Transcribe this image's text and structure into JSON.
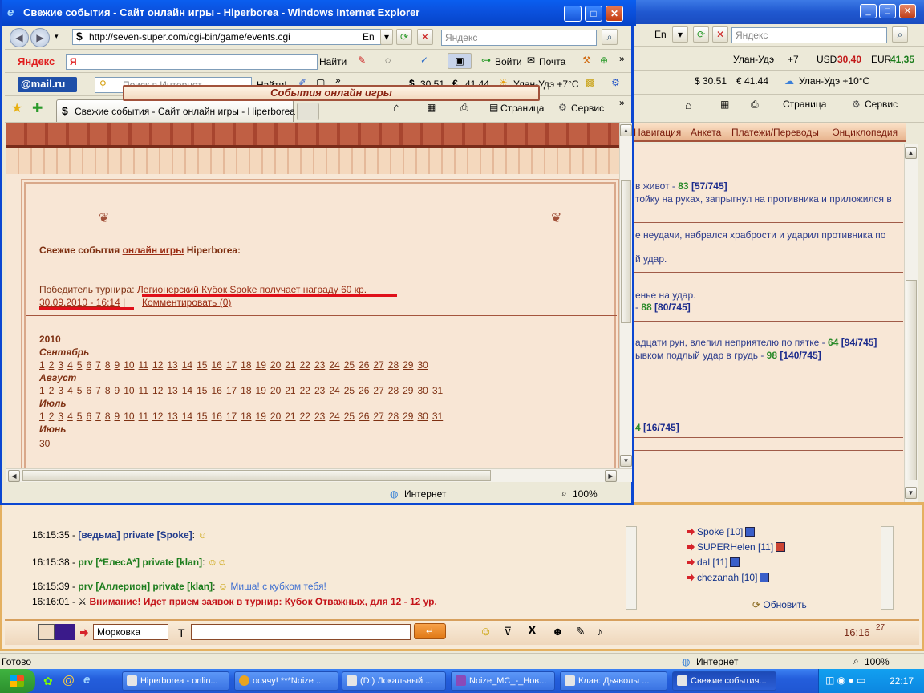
{
  "foreground": {
    "window_title": "Свежие события - Сайт онлайн игры - Hiperborea - Windows Internet Explorer",
    "address": "http://seven-super.com/cgi-bin/game/events.cgi",
    "address_lang": "En",
    "search_placeholder": "Яндекс",
    "yandex_logo": "Яндекс",
    "yandex_input": "Я",
    "find_label": "Найти",
    "login_label": "Войти",
    "mail_label": "Почта",
    "mailru_logo": "@mail.ru",
    "mailru_search_placeholder": "Поиск в Интернет",
    "mailru_find": "Найти!",
    "usd_rate": "30.51",
    "eur_rate": "41.44",
    "weather": "Улан-Удэ +7°C",
    "tab_title": "Свежие события - Сайт онлайн игры - Hiperborea",
    "page_menu": "Страница",
    "service_menu": "Сервис",
    "status_zone": "Интернет",
    "zoom": "100%"
  },
  "content": {
    "banner": "События онлайн игры",
    "heading_pre": "Свежие события",
    "heading_link": "онлайн игры",
    "heading_post": "Hiperborea:",
    "winner_label": "Победитель турнира:",
    "winner_text": "Легионерский Кубок Spoke получает награду 60 кр.",
    "date": "30.09.2010 - 16:14",
    "sep": "|",
    "comment": "Комментировать (0)",
    "year": "2010",
    "months": [
      {
        "name": "Сентябрь",
        "days": [
          "1",
          "2",
          "3",
          "4",
          "5",
          "6",
          "7",
          "8",
          "9",
          "10",
          "11",
          "12",
          "13",
          "14",
          "15",
          "16",
          "17",
          "18",
          "19",
          "20",
          "21",
          "22",
          "23",
          "24",
          "25",
          "26",
          "27",
          "28",
          "29",
          "30"
        ]
      },
      {
        "name": "Август",
        "days": [
          "1",
          "2",
          "3",
          "4",
          "5",
          "6",
          "7",
          "8",
          "9",
          "10",
          "11",
          "12",
          "13",
          "14",
          "15",
          "16",
          "17",
          "18",
          "19",
          "20",
          "21",
          "22",
          "23",
          "24",
          "25",
          "26",
          "27",
          "28",
          "29",
          "30",
          "31"
        ]
      },
      {
        "name": "Июль",
        "days": [
          "1",
          "2",
          "3",
          "4",
          "5",
          "6",
          "7",
          "8",
          "9",
          "10",
          "11",
          "12",
          "13",
          "14",
          "15",
          "16",
          "17",
          "18",
          "19",
          "20",
          "21",
          "22",
          "23",
          "24",
          "25",
          "26",
          "27",
          "28",
          "29",
          "30",
          "31"
        ]
      },
      {
        "name": "Июнь",
        "days": [
          "30"
        ]
      }
    ]
  },
  "background": {
    "address_lang": "En",
    "search_placeholder": "Яндекс",
    "city": "Улан-Удэ",
    "temp": "+7",
    "usd_label": "USD",
    "usd_value": "30,40",
    "eur_label": "EUR",
    "eur_value": "41,35",
    "usd_rate": "30.51",
    "eur_rate": "41.44",
    "weather": "Улан-Удэ +10°C",
    "page_menu": "Страница",
    "service_menu": "Сервис",
    "nav": [
      "Навигация",
      "Анкета",
      "Платежи/Переводы",
      "Энциклопедия"
    ],
    "log": [
      {
        "pre": "в живот - ",
        "g": "83",
        "n": "[57/745]"
      },
      {
        "pre": "тойку на руках, запрыгнул на противника и приложился в",
        "g": "",
        "n": ""
      },
      {
        "pre": "е неудачи, набрался храбрости и ударил противника по",
        "g": "",
        "n": ""
      },
      {
        "pre": "й удар.",
        "g": "",
        "n": ""
      },
      {
        "pre": "енье на удар.",
        "g": "",
        "n": ""
      },
      {
        "pre": " - ",
        "g": "88",
        "n": "[80/745]"
      },
      {
        "pre": "адцати рун, влепил неприятелю по пятке - ",
        "g": "64",
        "n": "[94/745]"
      },
      {
        "pre": "ывком подлый удар в грудь - ",
        "g": "98",
        "n": "[140/745]"
      },
      {
        "pre": "",
        "g": "4",
        "n": "[16/745]"
      }
    ],
    "status_left": "Готово",
    "status_zone": "Интернет",
    "zoom": "100%"
  },
  "chat": {
    "lines": [
      {
        "time": "16:15:35 - ",
        "nick": "[ведьма] private [Spoke]",
        "tail": ":",
        "msg": ""
      },
      {
        "time": "16:15:38 - ",
        "nick": "prv [*ЕлесА*] private [klan]",
        "tail": ":",
        "msg": ""
      },
      {
        "time": "16:15:39 - ",
        "nick": "prv [Аллерион] private [klan]",
        "tail": ":",
        "msg": "Миша! с кубком тебя!"
      }
    ],
    "alert_time": "16:16:01 - ",
    "alert": "Внимание! Идет прием заявок в турнир: Кубок Отважных, для 12 - 12 ур.",
    "users": [
      {
        "name": "Spoke",
        "level": "[10]"
      },
      {
        "name": "SUPERHelen",
        "level": "[11]"
      },
      {
        "name": "dal",
        "level": "[11]"
      },
      {
        "name": "chezanah",
        "level": "[10]"
      }
    ],
    "refresh": "Обновить",
    "name_value": "Морковка",
    "text_label": "T",
    "clock": "16:16",
    "clock_sec": "27"
  },
  "taskbar": {
    "tasks": [
      "Hiperborea - onlin...",
      "осячу! ***Noize ...",
      "(D:) Локальный ...",
      "Noize_MC_-_Нов...",
      "Клан: Дьяволы ...",
      "Свежие события..."
    ],
    "time": "22:17"
  }
}
